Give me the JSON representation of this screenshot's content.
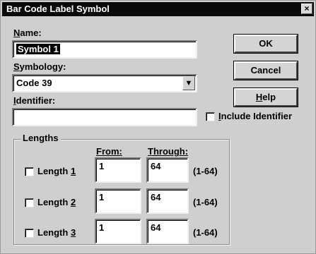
{
  "window": {
    "title": "Bar Code Label Symbol",
    "close_glyph": "×"
  },
  "name": {
    "label_accel": "N",
    "label_rest": "ame:",
    "value": "Symbol 1"
  },
  "symbology": {
    "label_accel": "S",
    "label_rest": "ymbology:",
    "value": "Code 39",
    "dropdown_glyph": "▼"
  },
  "identifier": {
    "label_accel": "I",
    "label_rest": "dentifier:",
    "value": "",
    "include_accel": "I",
    "include_rest": "nclude Identifier",
    "include_checked": false
  },
  "buttons": {
    "ok": "OK",
    "cancel": "Cancel",
    "help_accel": "H",
    "help_rest": "elp"
  },
  "lengths": {
    "group_label": "Lengths",
    "from_label": "From:",
    "through_label": "Through:",
    "rows": [
      {
        "label": "Length ",
        "accel": "1",
        "checked": false,
        "from": "1",
        "through": "64",
        "range": "(1-64)"
      },
      {
        "label": "Length ",
        "accel": "2",
        "checked": false,
        "from": "1",
        "through": "64",
        "range": "(1-64)"
      },
      {
        "label": "Length ",
        "accel": "3",
        "checked": false,
        "from": "1",
        "through": "64",
        "range": "(1-64)"
      }
    ]
  }
}
